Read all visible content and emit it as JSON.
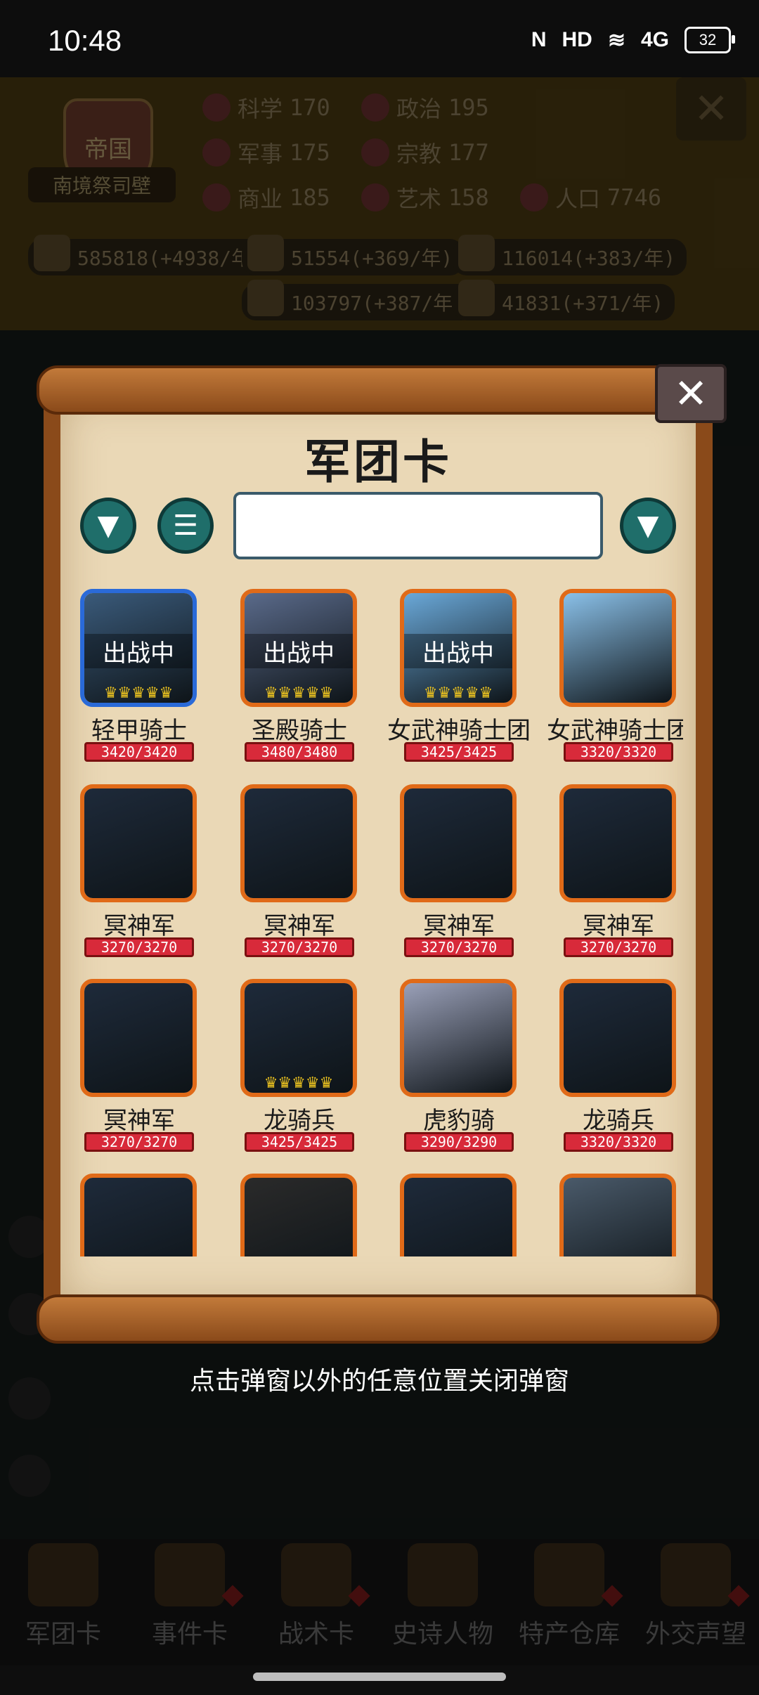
{
  "status_bar": {
    "time": "10:48",
    "icons": [
      "nfc-icon",
      "hd-icon",
      "wifi-icon",
      "signal-4g-icon"
    ],
    "nfc": "N",
    "hd": "HD",
    "wifi": "≋",
    "net": "4G",
    "battery": "32"
  },
  "header": {
    "emblem_char": "帝国",
    "player_title": "南境祭司壁",
    "stats": [
      {
        "label": "科学",
        "value": "170"
      },
      {
        "label": "政治",
        "value": "195"
      },
      {
        "label": "军事",
        "value": "175"
      },
      {
        "label": "宗教",
        "value": "177"
      },
      {
        "label": "商业",
        "value": "185"
      },
      {
        "label": "艺术",
        "value": "158"
      },
      {
        "label": "人口",
        "value": "7746"
      }
    ],
    "resources": [
      "585818(+4938/年)",
      "51554(+369/年)",
      "116014(+383/年)",
      "103797(+387/年)",
      "41831(+371/年)"
    ],
    "close": "✕"
  },
  "modal": {
    "title": "军团卡",
    "close": "✕",
    "sort_icon": "▼",
    "list_icon": "☰",
    "filter_icon": "▼",
    "search_value": "",
    "deployed_label": "出战中",
    "cards": [
      {
        "name": "轻甲骑士",
        "hp": "3420/3420",
        "deployed": true,
        "crowns": "♛♛♛♛♛",
        "frame": "blue",
        "bg": "#3a5a7a"
      },
      {
        "name": "圣殿骑士",
        "hp": "3480/3480",
        "deployed": true,
        "crowns": "♛♛♛♛♛",
        "frame": "orange",
        "bg": "#5a6a8a"
      },
      {
        "name": "女武神骑士团",
        "hp": "3425/3425",
        "deployed": true,
        "crowns": "♛♛♛♛♛",
        "frame": "orange",
        "bg": "#6aa8d8"
      },
      {
        "name": "女武神骑士团",
        "hp": "3320/3320",
        "deployed": false,
        "crowns": "",
        "frame": "orange",
        "bg": "#8ac0e8"
      },
      {
        "name": "冥神军",
        "hp": "3270/3270",
        "deployed": false,
        "crowns": "",
        "frame": "orange",
        "bg": "#1e2a3a"
      },
      {
        "name": "冥神军",
        "hp": "3270/3270",
        "deployed": false,
        "crowns": "",
        "frame": "orange",
        "bg": "#1e2a3a"
      },
      {
        "name": "冥神军",
        "hp": "3270/3270",
        "deployed": false,
        "crowns": "",
        "frame": "orange",
        "bg": "#1e2a3a"
      },
      {
        "name": "冥神军",
        "hp": "3270/3270",
        "deployed": false,
        "crowns": "",
        "frame": "orange",
        "bg": "#1e2a3a"
      },
      {
        "name": "冥神军",
        "hp": "3270/3270",
        "deployed": false,
        "crowns": "",
        "frame": "orange",
        "bg": "#1e2a3a"
      },
      {
        "name": "龙骑兵",
        "hp": "3425/3425",
        "deployed": false,
        "crowns": "♛♛♛♛♛",
        "frame": "orange",
        "bg": "#1e2a3a"
      },
      {
        "name": "虎豹骑",
        "hp": "3290/3290",
        "deployed": false,
        "crowns": "",
        "frame": "orange",
        "bg": "#9aa0b8"
      },
      {
        "name": "龙骑兵",
        "hp": "3320/3320",
        "deployed": false,
        "crowns": "",
        "frame": "orange",
        "bg": "#1e2a3a"
      },
      {
        "name": "",
        "hp": "",
        "deployed": false,
        "crowns": "",
        "frame": "orange",
        "bg": "#1e2a3a"
      },
      {
        "name": "",
        "hp": "",
        "deployed": false,
        "crowns": "",
        "frame": "orange",
        "bg": "#2a2a2a"
      },
      {
        "name": "",
        "hp": "",
        "deployed": false,
        "crowns": "",
        "frame": "orange",
        "bg": "#1e2a3a"
      },
      {
        "name": "",
        "hp": "",
        "deployed": false,
        "crowns": "",
        "frame": "orange",
        "bg": "#4a5a6a"
      }
    ],
    "hint": "点击弹窗以外的任意位置关闭弹窗"
  },
  "bottom_nav": [
    {
      "label": "军团卡"
    },
    {
      "label": "事件卡"
    },
    {
      "label": "战术卡"
    },
    {
      "label": "史诗人物"
    },
    {
      "label": "特产仓库"
    },
    {
      "label": "外交声望"
    }
  ]
}
